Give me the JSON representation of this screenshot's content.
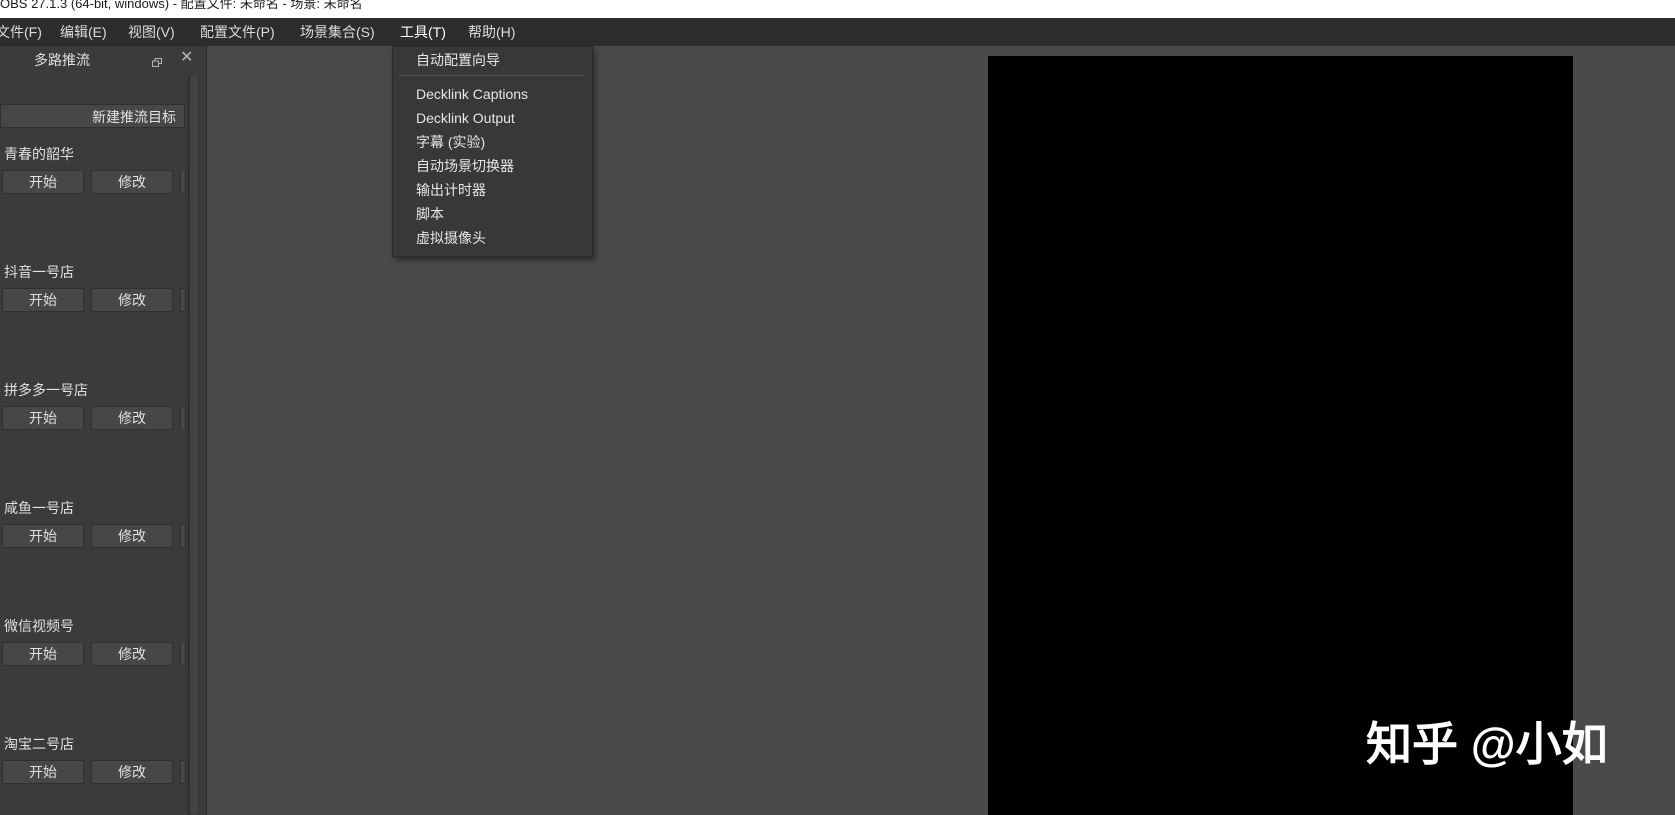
{
  "window": {
    "title": "OBS 27.1.3 (64-bit, windows) - 配置文件: 未命名 - 场景: 未命名"
  },
  "menubar": {
    "items": [
      {
        "label": "文件(F)"
      },
      {
        "label": "编辑(E)"
      },
      {
        "label": "视图(V)"
      },
      {
        "label": "配置文件(P)"
      },
      {
        "label": "场景集合(S)"
      },
      {
        "label": "工具(T)"
      },
      {
        "label": "帮助(H)"
      }
    ]
  },
  "tools_menu": {
    "items": [
      {
        "label": "自动配置向导"
      },
      {
        "label": "Decklink Captions"
      },
      {
        "label": "Decklink Output"
      },
      {
        "label": "字幕 (实验)"
      },
      {
        "label": "自动场景切换器"
      },
      {
        "label": "输出计时器"
      },
      {
        "label": "脚本"
      },
      {
        "label": "虚拟摄像头"
      }
    ]
  },
  "dock": {
    "title": "多路推流",
    "new_target_label": "新建推流目标",
    "entries": [
      {
        "name": "青春的韶华",
        "start_label": "开始",
        "edit_label": "修改"
      },
      {
        "name": "抖音一号店",
        "start_label": "开始",
        "edit_label": "修改"
      },
      {
        "name": "拼多多一号店",
        "start_label": "开始",
        "edit_label": "修改"
      },
      {
        "name": "咸鱼一号店",
        "start_label": "开始",
        "edit_label": "修改"
      },
      {
        "name": "微信视频号",
        "start_label": "开始",
        "edit_label": "修改"
      },
      {
        "name": "淘宝二号店",
        "start_label": "开始",
        "edit_label": "修改"
      }
    ]
  },
  "icons": {
    "dock_float": "float-icon",
    "dock_close": "close-icon"
  },
  "watermark": {
    "text": "知乎 @小如"
  },
  "colors": {
    "menubar_bg": "#2d2d2d",
    "dock_bg": "#3b3b3b",
    "preview_bg": "#4a4a4a",
    "canvas_bg": "#000000"
  }
}
